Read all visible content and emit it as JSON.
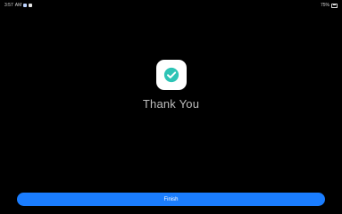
{
  "status_bar": {
    "time": "3:57",
    "carrier_text": "AM",
    "right_text": "75%"
  },
  "icons": {
    "check": "check-circle-icon",
    "battery": "battery-icon",
    "notification_a": "notification-icon",
    "notification_b": "notification-icon"
  },
  "colors": {
    "accent_button": "#1a7dff",
    "check_green": "#2ec4b6",
    "tile_bg": "#ffffff",
    "background": "#000000"
  },
  "main": {
    "title": "Thank You",
    "finish_label": "Finish"
  }
}
